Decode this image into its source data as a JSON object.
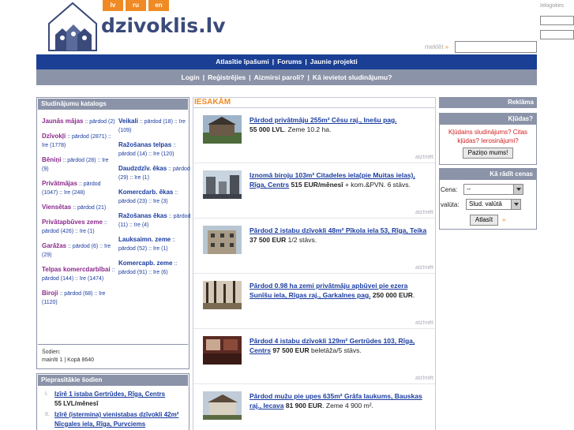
{
  "header": {
    "logo_text": "dzivoklis.lv",
    "languages": [
      "lv",
      "ru",
      "en"
    ],
    "login_title": "Ielogoties",
    "search_label": "meklēt",
    "search_arrow": "»"
  },
  "nav1": [
    "Atlasītie īpašumi",
    "Forums",
    "Jaunie projekti"
  ],
  "nav2": [
    "Login",
    "Reģistrējies",
    "Aizmirsi paroli?",
    "Kā ievietot sludinājumu?"
  ],
  "nav_separator": "|",
  "catalog": {
    "title": "Sludinājumu katalogs",
    "left": [
      {
        "name": "Jaunās mājas",
        "detail": ":: pārdod (2)"
      },
      {
        "name": "Dzīvokļi",
        "detail": ":: pārdod (2871) :: īre (1778)"
      },
      {
        "name": "Bēniņi",
        "detail": ":: pārdod (28) :: īre (9)"
      },
      {
        "name": "Privātmājas",
        "detail": ":: pārdod (1047) :: īre (248)"
      },
      {
        "name": "Viensētas",
        "detail": ":: pārdod (21)"
      },
      {
        "name": "Privātapbūves zeme",
        "detail": ":: pārdod (426) :: īre (1)"
      },
      {
        "name": "Garāžas",
        "detail": ":: pārdod (6) :: īre (29)"
      },
      {
        "name": "Telpas komercdarbībai",
        "detail": ":: pārdod (144) :: īre (1474)"
      },
      {
        "name": "Biroji",
        "detail": ":: pārdod (68) :: īre (1120)"
      }
    ],
    "right": [
      {
        "name": "Veikali",
        "detail": ":: pārdod (18) :: īre (109)"
      },
      {
        "name": "Ražošanas telpas",
        "detail": ":: pārdod (14) :: īre (120)"
      },
      {
        "name": "Daudzdzīv. ēkas",
        "detail": ":: pārdod (29) :: īre (1)"
      },
      {
        "name": "Komercdarb. ēkas",
        "detail": ":: pārdod (23) :: īre (3)"
      },
      {
        "name": "Ražošanas ēkas",
        "detail": ":: pārdod (11) :: īre (4)"
      },
      {
        "name": "Lauksaimn. zeme",
        "detail": ":: pārdod (52) :: īre (1)"
      },
      {
        "name": "Komercapb. zeme",
        "detail": ":: pārdod (91) :: īre (6)"
      }
    ],
    "today_label": "Šodien:",
    "today_value": "mainīti 1 | Kopā 8640"
  },
  "popular": {
    "title": "Pieprasītākie šodien",
    "items": [
      {
        "num": "I.",
        "title": "Izīrē 1 istaba Gertrūdes, Rīga, Centrs",
        "price": "55 LVL/mēnesī"
      },
      {
        "num": "II.",
        "title": "Izīrē (istermina) vienistabas dzīvokli 42m² Nīcgales iela, Rīga, Purvciems",
        "price": ""
      }
    ]
  },
  "recommend": {
    "title": "IESAKĀM",
    "mark_label": "atzīmēt",
    "items": [
      {
        "title": "Pārdod privātmāju 255m² Cēsu raj., Inešu pag.",
        "price": "55 000 LVL",
        "details": ". Zeme 10.2 ha."
      },
      {
        "title": "Iznomā biroju 103m² Citadeles iela(pie Muitas ielas), Rīga, Centrs",
        "price": "515 EUR/mēnesī",
        "details": " + kom.&PVN. 6 stāvs."
      },
      {
        "title": "Pārdod 2 istabu dzīvokli 48m² Pīkola iela 53, Rīga, Teika",
        "price": "37 500 EUR",
        "details": " 1/2 stāvs."
      },
      {
        "title": "Pārdod 0.98 ha zemi privātmāju apbūvei pie ezera Sunīšu iela, Rīgas raj., Garkalnes pag.",
        "price": "250 000 EUR",
        "details": "."
      },
      {
        "title": "Pārdod 4 istabu dzīvokli 129m² Gertrūdes 103, Rīga, Centrs",
        "price": "97 500 EUR",
        "details": " beletāža/5 stāvs."
      },
      {
        "title": "Pārdod mužu pie upes 635m² Grāfa laukums, Bauskas raj., Iecava",
        "price": "81 900 EUR",
        "details": ". Zeme 4 900 m²."
      }
    ]
  },
  "ads": {
    "title": "Reklāma"
  },
  "errors": {
    "title": "Kļūdas?",
    "text": "Kļūdains sludinājums? Citas kļūdas? Ierosinājumi?",
    "button": "Paziņo mums!"
  },
  "price": {
    "title": "Kā rādīt cenas",
    "price_label": "Cena:",
    "price_value": "--",
    "currency_label": "valūta:",
    "currency_value": "Slud. valūtā",
    "button": "Atlasīt",
    "arrow": "»"
  },
  "colors": {
    "accent_orange": "#f08a24",
    "nav_blue": "#1a3f94",
    "nav_gray": "#8b93a8",
    "link_blue": "#1a3ca0",
    "catalog_purple": "#8b2a8b",
    "error_red": "#d02020"
  },
  "icons": [
    "houses-logo-icon",
    "dropdown-arrow-icon"
  ]
}
